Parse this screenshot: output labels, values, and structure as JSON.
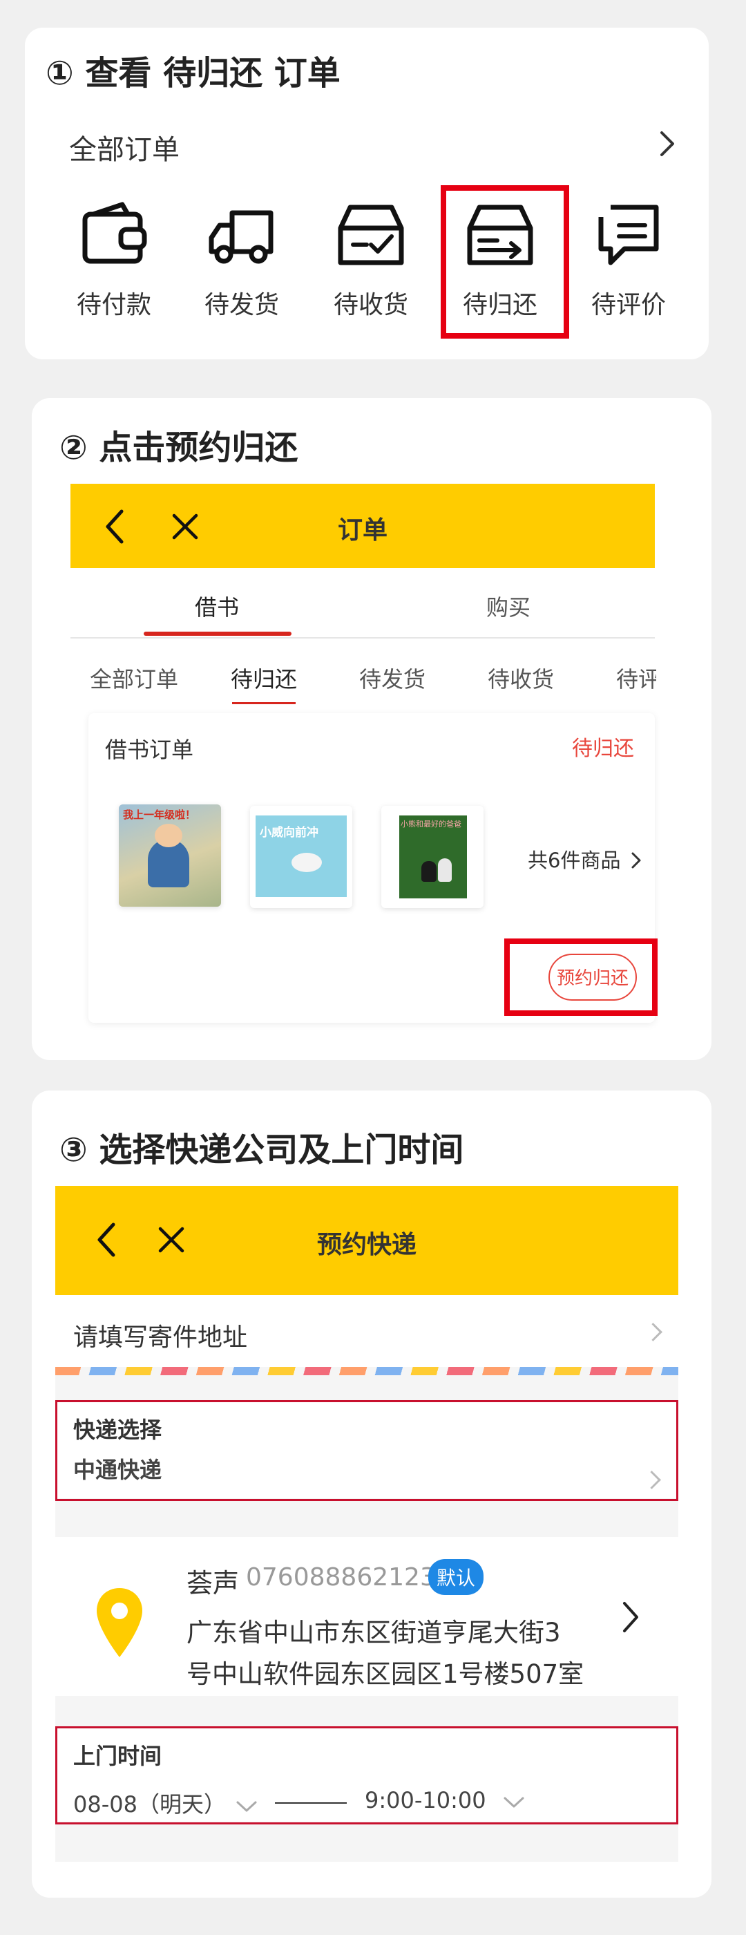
{
  "step1": {
    "title": "① 查看 待归还 订单",
    "all_orders_label": "全部订单",
    "order_items": [
      {
        "label": "待付款",
        "icon": "wallet-icon"
      },
      {
        "label": "待发货",
        "icon": "truck-icon"
      },
      {
        "label": "待收货",
        "icon": "box-check-icon"
      },
      {
        "label": "待归还",
        "icon": "return-box-icon"
      },
      {
        "label": "待评价",
        "icon": "comment-icon"
      }
    ]
  },
  "step2": {
    "title": "② 点击预约归还",
    "header_title": "订单",
    "main_tabs": [
      "借书",
      "购买"
    ],
    "sub_tabs": [
      "全部订单",
      "待归还",
      "待发货",
      "待收货",
      "待评"
    ],
    "order_card": {
      "title": "借书订单",
      "status": "待归还",
      "book_count": "共6件商品",
      "return_button": "预约归还",
      "books": [
        {
          "title_text": "我上一年级啦！"
        },
        {
          "title_text": "小威向前冲"
        },
        {
          "title_text": "小熊和最好的爸爸"
        }
      ]
    }
  },
  "step3": {
    "title": "③ 选择快递公司及上门时间",
    "header_title": "预约快递",
    "sender_address_placeholder": "请填写寄件地址",
    "courier_label": "快递选择",
    "courier_value": "中通快递",
    "contact": {
      "name": "荟声",
      "phone": "076088862123",
      "default_badge": "默认",
      "address_line1": "广东省中山市东区街道亨尾大街3",
      "address_line2": "号中山软件园东区园区1号楼507室"
    },
    "pickup": {
      "label": "上门时间",
      "date": "08-08（明天）",
      "time": "9:00-10:00"
    }
  },
  "colors": {
    "brand_yellow": "#ffcc00",
    "highlight_red": "#e60012",
    "status_red": "#e8463c",
    "badge_blue": "#1e88e5"
  }
}
